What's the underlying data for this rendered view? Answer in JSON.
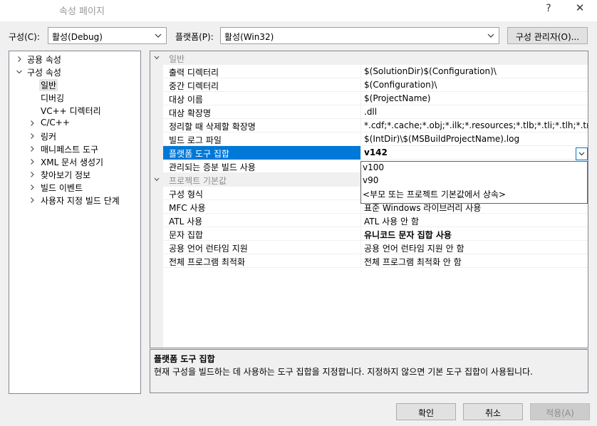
{
  "window": {
    "title": "속성 페이지",
    "help": "?",
    "close": "✕"
  },
  "toolbar": {
    "config_label": "구성(C):",
    "config_value": "활성(Debug)",
    "platform_label": "플랫폼(P):",
    "platform_value": "활성(Win32)",
    "config_manager": "구성 관리자(O)..."
  },
  "tree": [
    {
      "label": "공용 속성",
      "level": 0,
      "expander": "collapsed"
    },
    {
      "label": "구성 속성",
      "level": 0,
      "expander": "expanded"
    },
    {
      "label": "일반",
      "level": 1,
      "expander": "none",
      "selected": true
    },
    {
      "label": "디버깅",
      "level": 1,
      "expander": "none"
    },
    {
      "label": "VC++ 디렉터리",
      "level": 1,
      "expander": "none"
    },
    {
      "label": "C/C++",
      "level": 1,
      "expander": "collapsed"
    },
    {
      "label": "링커",
      "level": 1,
      "expander": "collapsed"
    },
    {
      "label": "매니페스트 도구",
      "level": 1,
      "expander": "collapsed"
    },
    {
      "label": "XML 문서 생성기",
      "level": 1,
      "expander": "collapsed"
    },
    {
      "label": "찾아보기 정보",
      "level": 1,
      "expander": "collapsed"
    },
    {
      "label": "빌드 이벤트",
      "level": 1,
      "expander": "collapsed"
    },
    {
      "label": "사용자 지정 빌드 단계",
      "level": 1,
      "expander": "collapsed"
    }
  ],
  "grid": {
    "general": {
      "category": "일반",
      "rows": [
        {
          "name": "출력 디렉터리",
          "value": "$(SolutionDir)$(Configuration)\\"
        },
        {
          "name": "중간 디렉터리",
          "value": "$(Configuration)\\"
        },
        {
          "name": "대상 이름",
          "value": "$(ProjectName)"
        },
        {
          "name": "대상 확장명",
          "value": ".dll"
        },
        {
          "name": "정리할 때 삭제할 확장명",
          "value": "*.cdf;*.cache;*.obj;*.ilk;*.resources;*.tlb;*.tli;*.tlh;*.tmp;*.rsp;*.pg"
        },
        {
          "name": "빌드 로그 파일",
          "value": "$(IntDir)\\$(MSBuildProjectName).log"
        },
        {
          "name": "플랫폼 도구 집합",
          "value": "v142",
          "selected": true
        },
        {
          "name": "관리되는 증분 빌드 사용",
          "value": ""
        }
      ]
    },
    "defaults": {
      "category": "프로젝트 기본값",
      "rows": [
        {
          "name": "구성 형식",
          "value": ""
        },
        {
          "name": "MFC 사용",
          "value": "표준 Windows 라이브러리 사용"
        },
        {
          "name": "ATL 사용",
          "value": "ATL 사용 안 함"
        },
        {
          "name": "문자 집합",
          "value": "유니코드 문자 집합 사용",
          "bold": true
        },
        {
          "name": "공용 언어 런타임 지원",
          "value": "공용 언어 런타임 지원 안 함"
        },
        {
          "name": "전체 프로그램 최적화",
          "value": "전체 프로그램 최적화 안 함"
        }
      ]
    }
  },
  "dropdown": {
    "options": [
      "v100",
      "v90",
      "<부모 또는 프로젝트 기본값에서 상속>"
    ]
  },
  "description": {
    "title": "플랫폼 도구 집합",
    "text": "현재 구성을 빌드하는 데 사용하는 도구 집합을 지정합니다. 지정하지 않으면 기본 도구 집합이 사용됩니다."
  },
  "buttons": {
    "ok": "확인",
    "cancel": "취소",
    "apply": "적용(A)"
  },
  "colors": {
    "selection": "#0078d7",
    "disabled_text": "#8c8c8c"
  }
}
